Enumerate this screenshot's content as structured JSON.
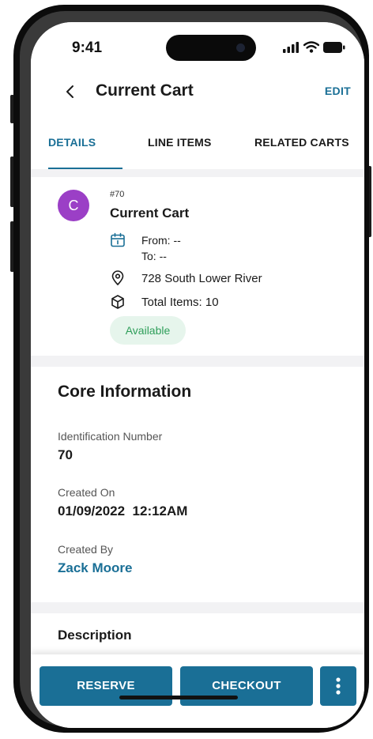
{
  "status_bar": {
    "time": "9:41"
  },
  "header": {
    "title": "Current Cart",
    "edit_label": "EDIT"
  },
  "tabs": [
    {
      "label": "DETAILS",
      "active": true
    },
    {
      "label": "LINE ITEMS",
      "active": false
    },
    {
      "label": "RELATED CARTS",
      "active": false
    }
  ],
  "summary": {
    "avatar_letter": "C",
    "number": "#70",
    "name": "Current Cart",
    "from": "From: --",
    "to": "To: --",
    "location": "728 South Lower River",
    "total_items": "Total Items: 10",
    "status": "Available"
  },
  "core_info": {
    "title": "Core Information",
    "fields": [
      {
        "label": "Identification Number",
        "value": "70"
      },
      {
        "label": "Created On",
        "value": "01/09/2022  12:12AM"
      },
      {
        "label": "Created By",
        "value": "Zack Moore"
      }
    ]
  },
  "description": {
    "title": "Description"
  },
  "actions": {
    "reserve_label": "RESERVE",
    "checkout_label": "CHECKOUT"
  },
  "colors": {
    "accent": "#1a6f96",
    "avatar": "#9b3fc6",
    "status_bg": "#e6f5ec",
    "status_text": "#2f9e5a"
  }
}
